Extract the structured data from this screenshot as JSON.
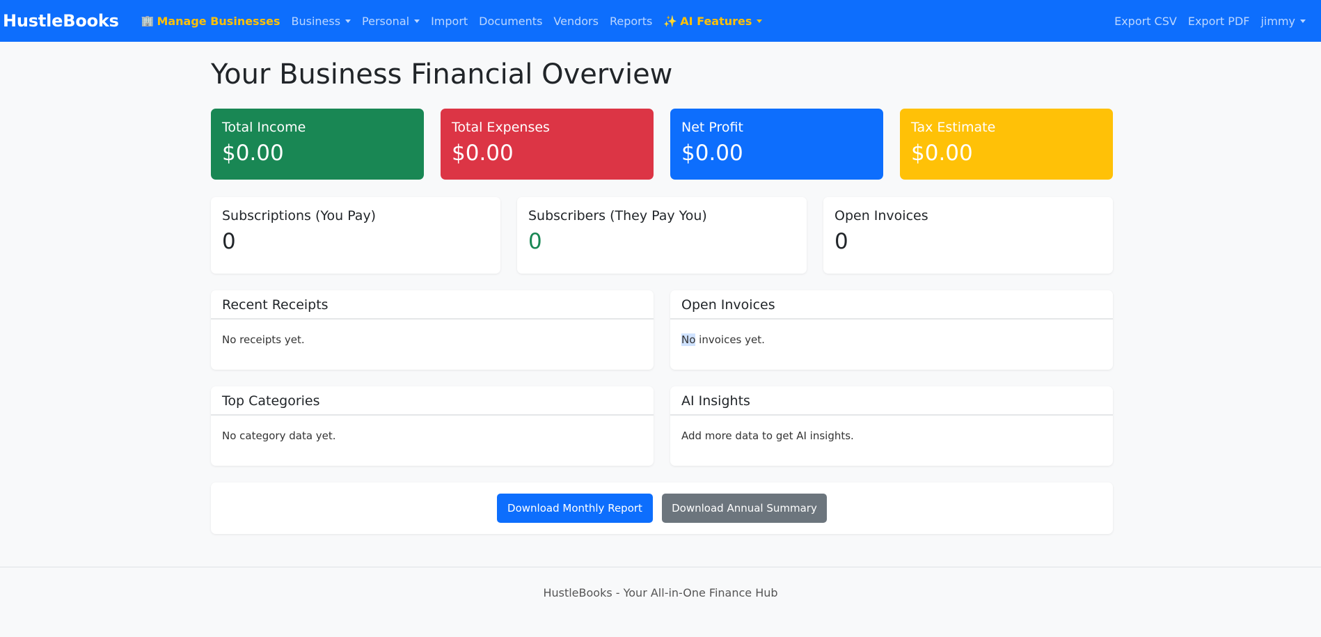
{
  "navbar": {
    "brand": "HustleBooks",
    "manage_businesses": "Manage Businesses",
    "business": "Business",
    "personal": "Personal",
    "import": "Import",
    "documents": "Documents",
    "vendors": "Vendors",
    "reports": "Reports",
    "ai_features": "AI Features",
    "export_csv": "Export CSV",
    "export_pdf": "Export PDF",
    "user": "jimmy",
    "icons": {
      "manage": "building-icon",
      "ai": "sparkles-icon"
    }
  },
  "page": {
    "title": "Your Business Financial Overview"
  },
  "stats": [
    {
      "label": "Total Income",
      "value": "$0.00",
      "color": "#198754"
    },
    {
      "label": "Total Expenses",
      "value": "$0.00",
      "color": "#dc3545"
    },
    {
      "label": "Net Profit",
      "value": "$0.00",
      "color": "#0d6efd"
    },
    {
      "label": "Tax Estimate",
      "value": "$0.00",
      "color": "#ffc107"
    }
  ],
  "counts": [
    {
      "label": "Subscriptions (You Pay)",
      "value": "0"
    },
    {
      "label": "Subscribers (They Pay You)",
      "value": "0"
    },
    {
      "label": "Open Invoices",
      "value": "0"
    }
  ],
  "panels": {
    "receipts": {
      "title": "Recent Receipts",
      "body": "No receipts yet."
    },
    "invoices": {
      "title": "Open Invoices",
      "body_hl": "No",
      "body_rest": " invoices yet."
    },
    "categories": {
      "title": "Top Categories",
      "body": "No category data yet."
    },
    "insights": {
      "title": "AI Insights",
      "body": "Add more data to get AI insights."
    }
  },
  "buttons": {
    "monthly": "Download Monthly Report",
    "annual": "Download Annual Summary"
  },
  "footer": {
    "text": "HustleBooks - Your All-in-One Finance Hub"
  },
  "colors": {
    "navbar": "#0d6efd",
    "accent": "#ffc107"
  }
}
